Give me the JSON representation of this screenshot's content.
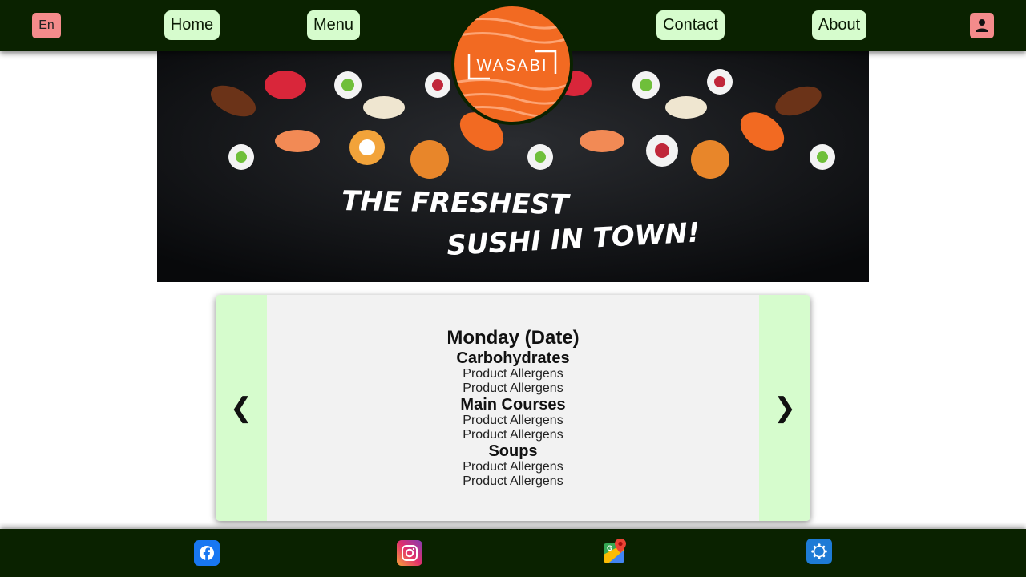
{
  "header": {
    "language_label": "En",
    "nav": [
      "Home",
      "Menu",
      "Contact",
      "About"
    ],
    "logo_text": "WASABI"
  },
  "hero": {
    "tagline_line1": "THE FRESHEST",
    "tagline_line2": "SUSHI IN TOWN!"
  },
  "carousel": {
    "prev_label": "❮",
    "next_label": "❯",
    "day_title": "Monday (Date)",
    "sections": [
      {
        "title": "Carbohydrates",
        "items": [
          "Product Allergens",
          "Product Allergens"
        ]
      },
      {
        "title": "Main Courses",
        "items": [
          "Product Allergens",
          "Product Allergens"
        ]
      },
      {
        "title": "Soups",
        "items": [
          "Product Allergens",
          "Product Allergens"
        ]
      }
    ]
  },
  "footer": {
    "social_icons": [
      "facebook-icon",
      "instagram-icon",
      "google-maps-icon",
      "web-icon"
    ]
  },
  "colors": {
    "header_bg": "#0a2200",
    "nav_button_bg": "#d6fccd",
    "accent_pink": "#f48b8b",
    "carousel_bg": "#f2f2f2"
  }
}
